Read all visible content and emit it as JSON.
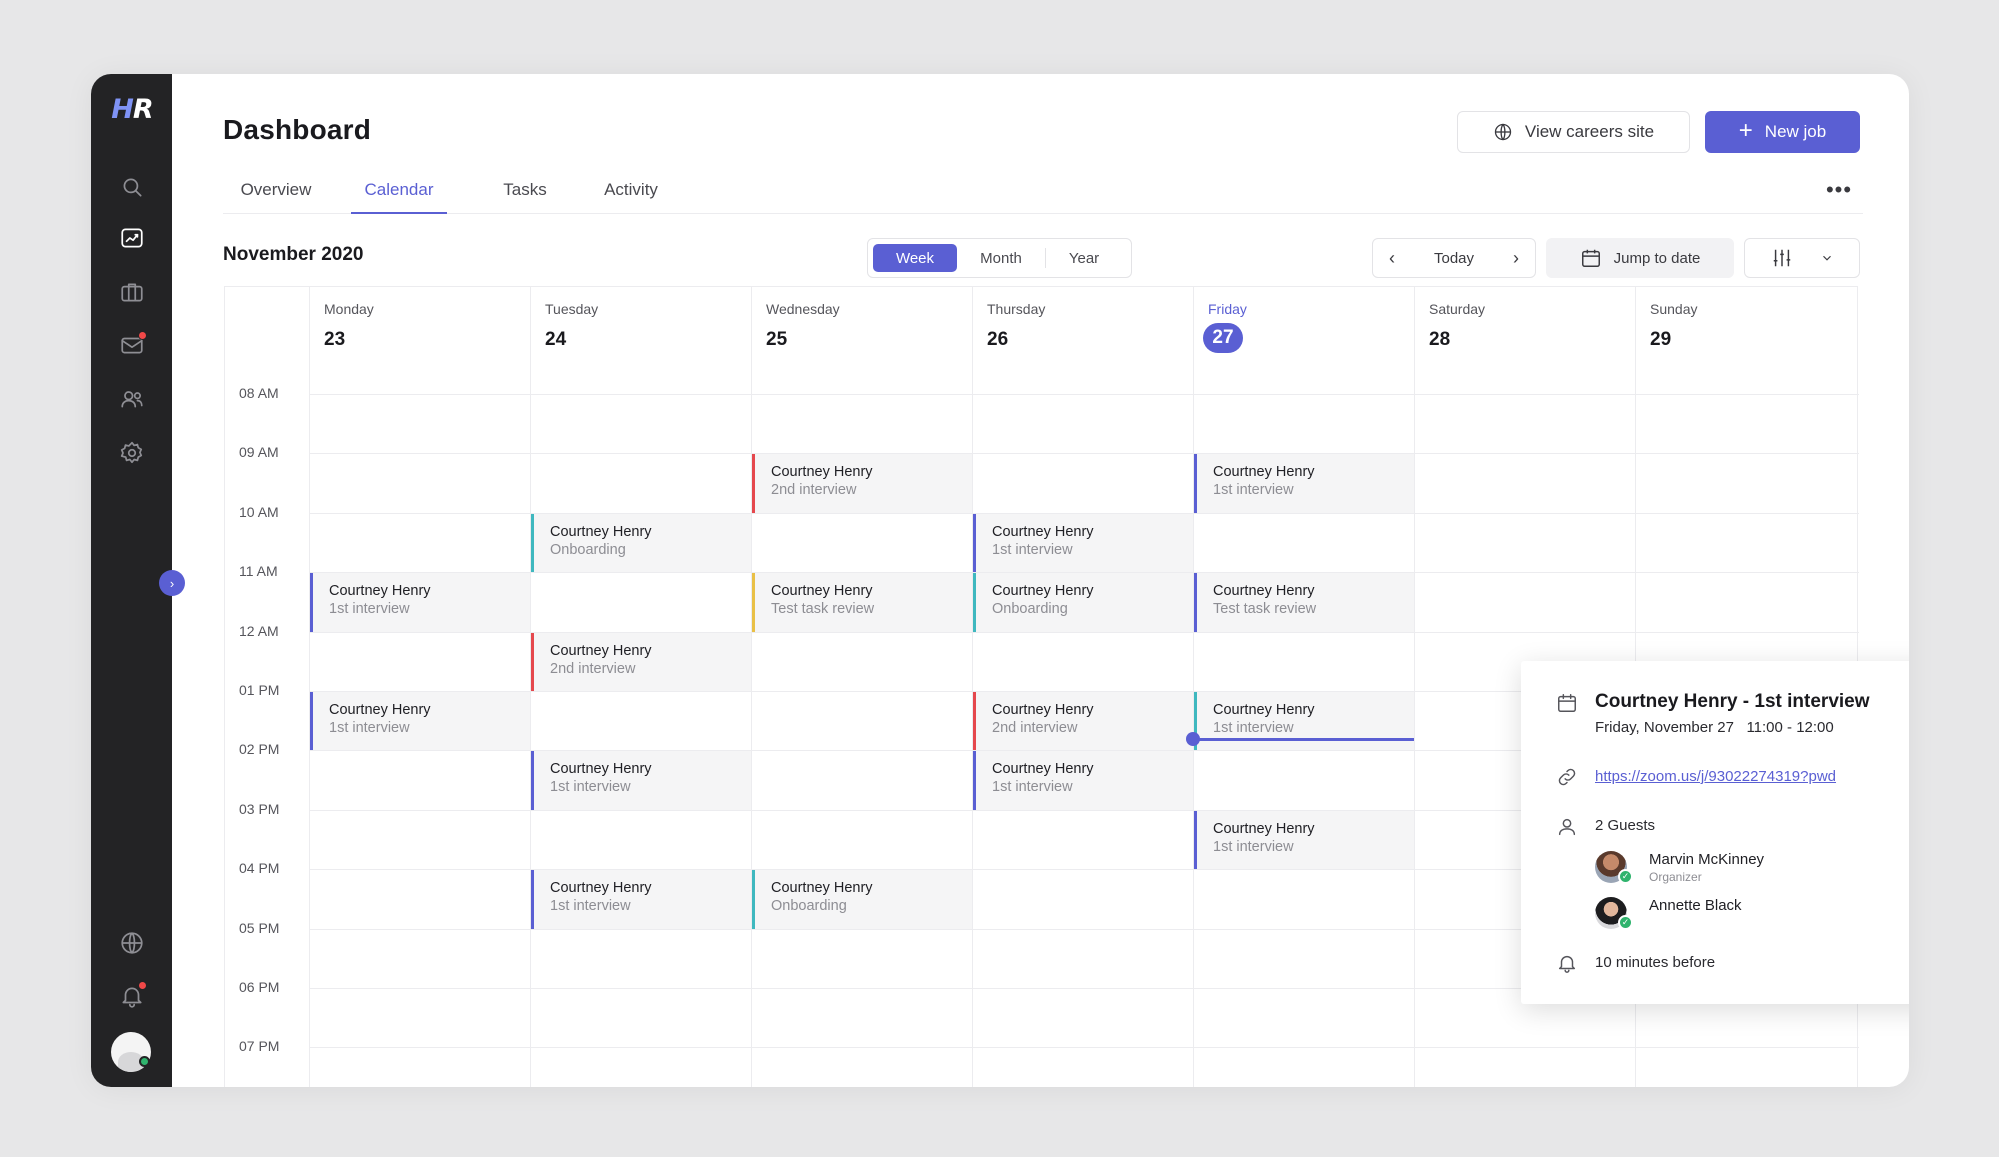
{
  "app": {
    "logo_text": "HR",
    "page_title": "Dashboard",
    "accent_color": "#5a5fd3"
  },
  "sidebar": {
    "items": [
      {
        "icon": "search-icon"
      },
      {
        "icon": "analytics-icon",
        "active": true
      },
      {
        "icon": "briefcase-icon"
      },
      {
        "icon": "mail-icon",
        "badge": true
      },
      {
        "icon": "users-icon"
      },
      {
        "icon": "settings-icon"
      }
    ],
    "bottom_items": [
      {
        "icon": "globe-icon"
      },
      {
        "icon": "bell-icon",
        "badge": true
      }
    ]
  },
  "header": {
    "view_careers_label": "View careers site",
    "new_job_label": "New job"
  },
  "tabs": [
    {
      "label": "Overview",
      "active": false
    },
    {
      "label": "Calendar",
      "active": true
    },
    {
      "label": "Tasks",
      "active": false
    },
    {
      "label": "Activity",
      "active": false
    }
  ],
  "toolbar": {
    "month_label": "November 2020",
    "view_modes": [
      "Week",
      "Month",
      "Year"
    ],
    "active_view": "Week",
    "today_label": "Today",
    "jump_label": "Jump to date"
  },
  "calendar": {
    "days": [
      {
        "name": "Monday",
        "num": "23"
      },
      {
        "name": "Tuesday",
        "num": "24"
      },
      {
        "name": "Wednesday",
        "num": "25"
      },
      {
        "name": "Thursday",
        "num": "26"
      },
      {
        "name": "Friday",
        "num": "27",
        "today": true
      },
      {
        "name": "Saturday",
        "num": "28"
      },
      {
        "name": "Sunday",
        "num": "29"
      }
    ],
    "hours": [
      "08 AM",
      "09 AM",
      "10 AM",
      "11 AM",
      "12 AM",
      "01 PM",
      "02 PM",
      "03 PM",
      "04 PM",
      "05 PM",
      "06 PM",
      "07 PM"
    ],
    "events": [
      {
        "day": 2,
        "hour": 1,
        "title": "Courtney Henry",
        "sub": "2nd interview",
        "color": "#e5484d"
      },
      {
        "day": 4,
        "hour": 1,
        "title": "Courtney Henry",
        "sub": "1st interview",
        "color": "#5a5fd3"
      },
      {
        "day": 1,
        "hour": 2,
        "title": "Courtney Henry",
        "sub": "Onboarding",
        "color": "#3fb8bf"
      },
      {
        "day": 3,
        "hour": 2,
        "title": "Courtney Henry",
        "sub": "1st interview",
        "color": "#5a5fd3"
      },
      {
        "day": 0,
        "hour": 3,
        "title": "Courtney Henry",
        "sub": "1st interview",
        "color": "#5a5fd3"
      },
      {
        "day": 2,
        "hour": 3,
        "title": "Courtney Henry",
        "sub": "Test task review",
        "color": "#e9c046"
      },
      {
        "day": 3,
        "hour": 3,
        "title": "Courtney Henry",
        "sub": "Onboarding",
        "color": "#3fb8bf"
      },
      {
        "day": 4,
        "hour": 3,
        "title": "Courtney Henry",
        "sub": "Test task review",
        "color": "#5a5fd3"
      },
      {
        "day": 1,
        "hour": 4,
        "title": "Courtney Henry",
        "sub": "2nd interview",
        "color": "#e5484d"
      },
      {
        "day": 0,
        "hour": 5,
        "title": "Courtney Henry",
        "sub": "1st interview",
        "color": "#5a5fd3"
      },
      {
        "day": 3,
        "hour": 5,
        "title": "Courtney Henry",
        "sub": "2nd interview",
        "color": "#e5484d"
      },
      {
        "day": 4,
        "hour": 5,
        "title": "Courtney Henry",
        "sub": "1st interview",
        "color": "#3fb8bf"
      },
      {
        "day": 1,
        "hour": 6,
        "title": "Courtney Henry",
        "sub": "1st interview",
        "color": "#5a5fd3"
      },
      {
        "day": 3,
        "hour": 6,
        "title": "Courtney Henry",
        "sub": "1st interview",
        "color": "#5a5fd3"
      },
      {
        "day": 4,
        "hour": 7,
        "title": "Courtney Henry",
        "sub": "1st interview",
        "color": "#5a5fd3"
      },
      {
        "day": 1,
        "hour": 8,
        "title": "Courtney Henry",
        "sub": "1st interview",
        "color": "#5a5fd3"
      },
      {
        "day": 2,
        "hour": 8,
        "title": "Courtney Henry",
        "sub": "Onboarding",
        "color": "#3fb8bf"
      }
    ]
  },
  "popup": {
    "title": "Courtney Henry - 1st interview",
    "date_time": "Friday, November 27   11:00 - 12:00",
    "link": "https://zoom.us/j/93022274319?pwd",
    "guests_label": "2 Guests",
    "guests": [
      {
        "name": "Marvin McKinney",
        "role": "Organizer"
      },
      {
        "name": "Annette Black",
        "role": ""
      }
    ],
    "reminder": "10 minutes before"
  }
}
